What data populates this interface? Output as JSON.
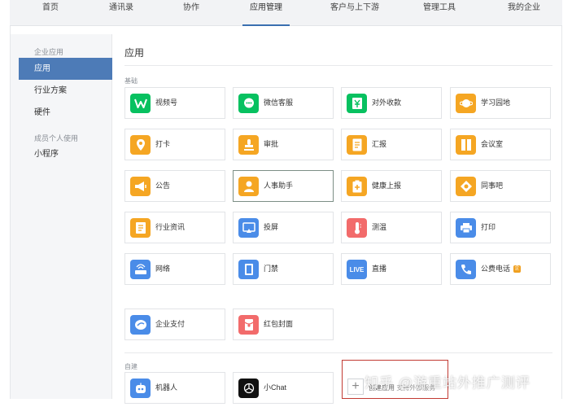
{
  "topnav": {
    "tabs": [
      {
        "label": "首页"
      },
      {
        "label": "通讯录"
      },
      {
        "label": "协作"
      },
      {
        "label": "应用管理"
      },
      {
        "label": "客户与上下游"
      },
      {
        "label": "管理工具"
      },
      {
        "label": "我的企业"
      }
    ],
    "active_tab": "应用管理",
    "active_color": "#3a6fb0"
  },
  "sidebar": {
    "group1": "企业应用",
    "items": [
      {
        "label": "应用"
      },
      {
        "label": "行业方案"
      },
      {
        "label": "硬件"
      }
    ],
    "group2": "成员个人使用",
    "items2": [
      {
        "label": "小程序"
      }
    ],
    "active_color": "#4d7bb7"
  },
  "main": {
    "title": "应用",
    "basic_label": "基础",
    "apps": [
      {
        "label": "视频号",
        "icon": "channels-icon",
        "color": "#07c160"
      },
      {
        "label": "微信客服",
        "icon": "wechat-service-icon",
        "color": "#07c160"
      },
      {
        "label": "对外收款",
        "icon": "payment-icon",
        "color": "#07c160"
      },
      {
        "label": "学习园地",
        "icon": "learning-icon",
        "color": "#f5a623"
      },
      {
        "label": "打卡",
        "icon": "checkin-icon",
        "color": "#f5a623"
      },
      {
        "label": "审批",
        "icon": "approval-icon",
        "color": "#f5a623"
      },
      {
        "label": "汇报",
        "icon": "report-icon",
        "color": "#f5a623"
      },
      {
        "label": "会议室",
        "icon": "meeting-room-icon",
        "color": "#f5a623"
      },
      {
        "label": "公告",
        "icon": "announcement-icon",
        "color": "#f5a623"
      },
      {
        "label": "人事助手",
        "icon": "hr-assistant-icon",
        "color": "#f5a623"
      },
      {
        "label": "健康上报",
        "icon": "health-report-icon",
        "color": "#f5a623"
      },
      {
        "label": "同事吧",
        "icon": "colleague-icon",
        "color": "#f5a623"
      },
      {
        "label": "行业资讯",
        "icon": "news-icon",
        "color": "#f5a623"
      },
      {
        "label": "投屏",
        "icon": "screencast-icon",
        "color": "#4a8ce8"
      },
      {
        "label": "测温",
        "icon": "thermometer-icon",
        "color": "#f26b6b"
      },
      {
        "label": "打印",
        "icon": "printer-icon",
        "color": "#4a8ce8"
      },
      {
        "label": "网络",
        "icon": "network-icon",
        "color": "#4a8ce8"
      },
      {
        "label": "门禁",
        "icon": "access-control-icon",
        "color": "#4a8ce8"
      },
      {
        "label": "直播",
        "icon": "live-icon",
        "color": "#4a8ce8"
      },
      {
        "label": "公费电话",
        "icon": "phone-icon",
        "color": "#4a8ce8"
      },
      {
        "label": "企业支付",
        "icon": "enterprise-pay-icon",
        "color": "#4a8ce8"
      },
      {
        "label": "红包封面",
        "icon": "red-packet-icon",
        "color": "#f26b6b"
      }
    ],
    "live_icon_text": "LIVE",
    "phone_badge": "企",
    "custom_label": "自建",
    "custom_apps": [
      {
        "label": "机器人",
        "icon": "robot-icon",
        "color": "#4a8ce8"
      },
      {
        "label": "小Chat",
        "icon": "chatgpt-icon",
        "color": "#111111"
      }
    ],
    "add_app": {
      "label": "创建应用",
      "sub": "支持外部服务"
    }
  },
  "watermark": "知乎 @游重站外推广测评"
}
